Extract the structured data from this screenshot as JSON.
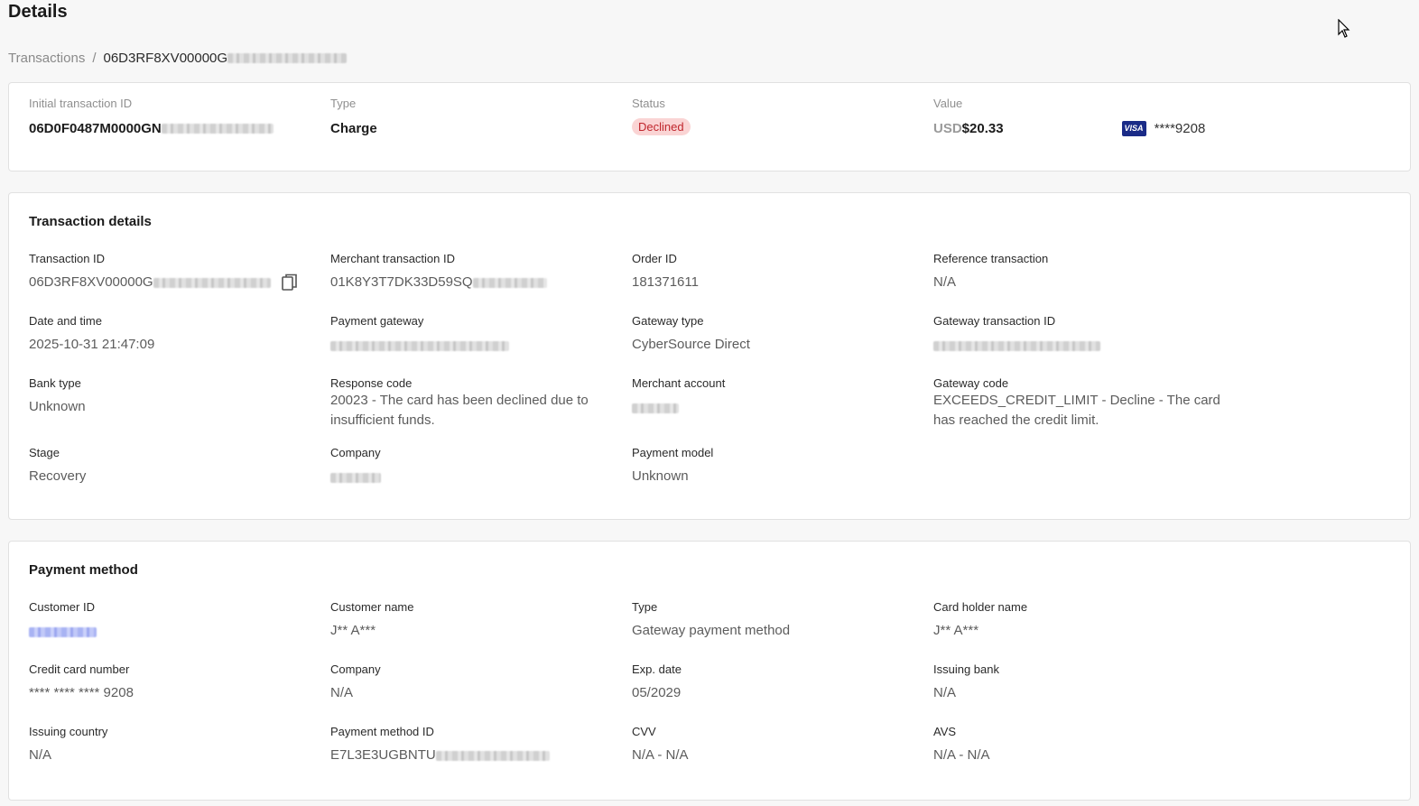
{
  "page": {
    "title": "Details"
  },
  "breadcrumb": {
    "parent": "Transactions",
    "separator": "/",
    "current_visible": "06D3RF8XV00000G"
  },
  "summary": {
    "initial_id_label": "Initial transaction ID",
    "initial_id_visible": "06D0F0487M0000GN",
    "type_label": "Type",
    "type_value": "Charge",
    "status_label": "Status",
    "status_value": "Declined",
    "value_label": "Value",
    "currency": "USD",
    "amount": "$20.33",
    "card_brand": "VISA",
    "card_masked": "****9208"
  },
  "transaction_details": {
    "title": "Transaction details",
    "transaction_id_label": "Transaction ID",
    "transaction_id_visible": "06D3RF8XV00000G",
    "merchant_txn_label": "Merchant transaction ID",
    "merchant_txn_visible": "01K8Y3T7DK33D59SQ",
    "order_id_label": "Order ID",
    "order_id": "181371611",
    "reference_label": "Reference transaction",
    "reference": "N/A",
    "date_label": "Date and time",
    "date": "2025-10-31 21:47:09",
    "payment_gateway_label": "Payment gateway",
    "gateway_type_label": "Gateway type",
    "gateway_type": "CyberSource Direct",
    "gateway_txn_label": "Gateway transaction ID",
    "bank_type_label": "Bank type",
    "bank_type": "Unknown",
    "response_code_label": "Response code",
    "response_code": "20023 - The card has been declined due to insufficient funds.",
    "merchant_account_label": "Merchant account",
    "gateway_code_label": "Gateway code",
    "gateway_code": "EXCEEDS_CREDIT_LIMIT - Decline - The card has reached the credit limit.",
    "stage_label": "Stage",
    "stage": "Recovery",
    "company_label": "Company",
    "payment_model_label": "Payment model",
    "payment_model": "Unknown"
  },
  "payment_method": {
    "title": "Payment method",
    "customer_id_label": "Customer ID",
    "customer_name_label": "Customer name",
    "customer_name": "J** A***",
    "type_label": "Type",
    "type": "Gateway payment method",
    "holder_label": "Card holder name",
    "holder": "J** A***",
    "cc_label": "Credit card number",
    "cc": "**** **** **** 9208",
    "company_label": "Company",
    "company": "N/A",
    "exp_label": "Exp. date",
    "exp": "05/2029",
    "bank_label": "Issuing bank",
    "bank": "N/A",
    "country_label": "Issuing country",
    "country": "N/A",
    "pm_id_label": "Payment method ID",
    "pm_id_visible": "E7L3E3UGBNTU",
    "cvv_label": "CVV",
    "cvv": "N/A - N/A",
    "avs_label": "AVS",
    "avs": "N/A - N/A"
  }
}
